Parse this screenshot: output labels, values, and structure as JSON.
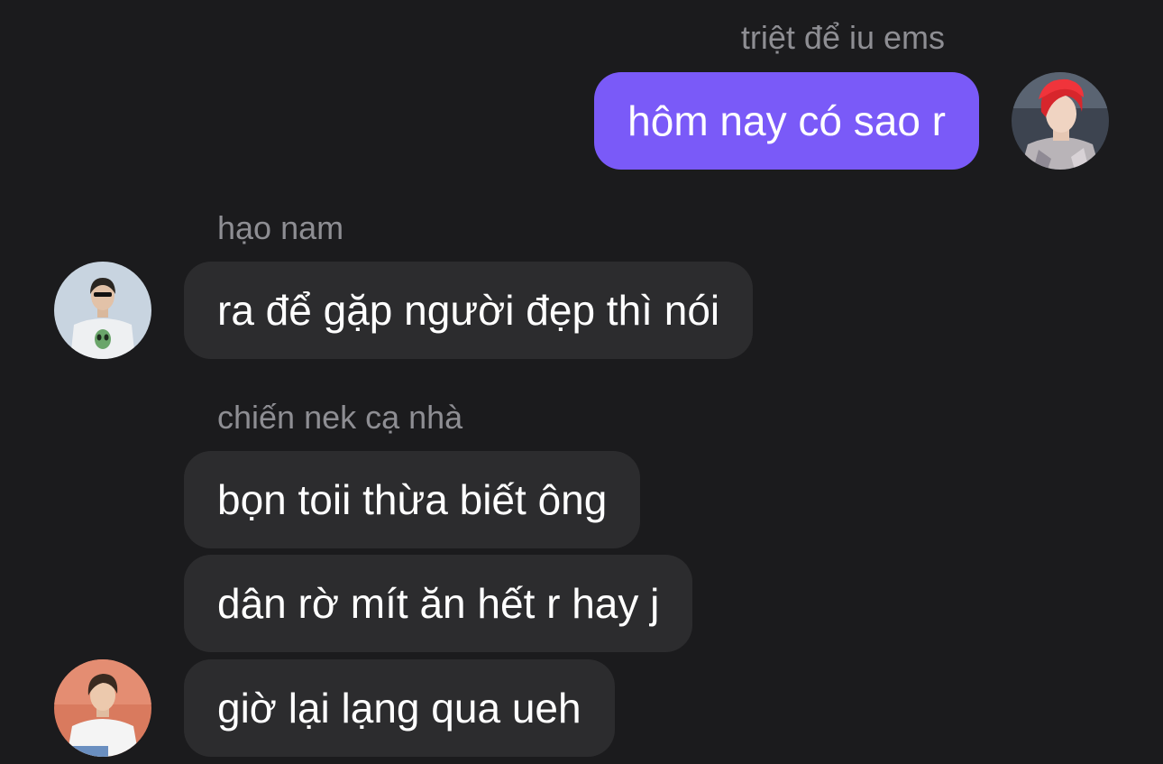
{
  "conversation": {
    "messages": [
      {
        "sender": "triệt để iu ems",
        "text": "hôm nay có sao r",
        "direction": "outgoing",
        "avatar_icon": "red-hair-person-avatar"
      },
      {
        "sender": "hạo nam",
        "text": "ra để gặp người đẹp thì nói",
        "direction": "incoming",
        "avatar_icon": "white-tshirt-person-avatar"
      },
      {
        "sender": "chiến nek cạ nhà",
        "text": "bọn toii thừa biết ông",
        "direction": "incoming"
      },
      {
        "text": "dân rờ mít ăn hết r hay j",
        "direction": "incoming"
      },
      {
        "text": "giờ lại lạng qua ueh",
        "direction": "incoming",
        "avatar_icon": "person-on-orange-background-avatar"
      }
    ]
  },
  "colors": {
    "background": "#1b1b1d",
    "outgoing_bubble": "#7a5af8",
    "incoming_bubble": "#2c2c2e",
    "sender_name": "#8e8e93",
    "message_text": "#ffffff"
  }
}
